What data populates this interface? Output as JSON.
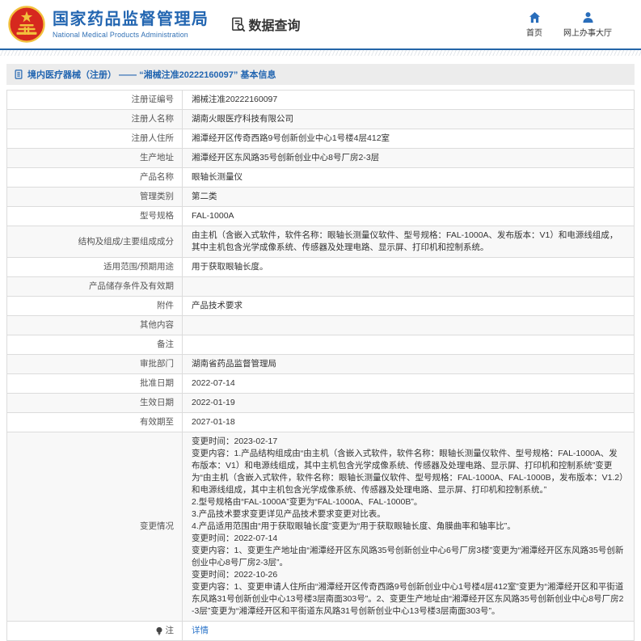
{
  "header": {
    "title": "国家药品监督管理局",
    "subtitle": "National Medical Products Administration",
    "section_label": "数据查询",
    "nav": [
      {
        "label": "首页",
        "icon": "home-icon"
      },
      {
        "label": "网上办事大厅",
        "icon": "user-icon"
      }
    ]
  },
  "breadcrumb": {
    "label": "境内医疗器械（注册） —— “湘械注准20222160097” 基本信息"
  },
  "colors": {
    "brand_blue": "#2366b1",
    "link_blue": "#2b74c9",
    "emblem_red": "#d6281e",
    "emblem_gold": "#f2c13d",
    "row_alt_bg": "#f8f8f8",
    "border_gray": "#dcdcdc"
  },
  "table": {
    "rows": [
      {
        "label": "注册证编号",
        "value": "湘械注准20222160097"
      },
      {
        "label": "注册人名称",
        "value": "湖南火眼医疗科技有限公司"
      },
      {
        "label": "注册人住所",
        "value": "湘潭经开区传奇西路9号创新创业中心1号楼4层412室"
      },
      {
        "label": "生产地址",
        "value": "湘潭经开区东风路35号创新创业中心8号厂房2-3层"
      },
      {
        "label": "产品名称",
        "value": "眼轴长测量仪"
      },
      {
        "label": "管理类别",
        "value": "第二类"
      },
      {
        "label": "型号规格",
        "value": "FAL-1000A"
      },
      {
        "label": "结构及组成/主要组成成分",
        "value": "由主机（含嵌入式软件，软件名称：眼轴长测量仪软件、型号规格：FAL-1000A、发布版本：V1）和电源线组成，其中主机包含光学成像系统、传感器及处理电路、显示屏、打印机和控制系统。"
      },
      {
        "label": "适用范围/预期用途",
        "value": "用于获取眼轴长度。"
      },
      {
        "label": "产品储存条件及有效期",
        "value": ""
      },
      {
        "label": "附件",
        "value": "产品技术要求"
      },
      {
        "label": "其他内容",
        "value": ""
      },
      {
        "label": "备注",
        "value": ""
      },
      {
        "label": "审批部门",
        "value": "湖南省药品监督管理局"
      },
      {
        "label": "批准日期",
        "value": "2022-07-14"
      },
      {
        "label": "生效日期",
        "value": "2022-01-19"
      },
      {
        "label": "有效期至",
        "value": "2027-01-18"
      },
      {
        "label": "变更情况",
        "value": "变更时间：2023-02-17\n变更内容：1.产品结构组成由“由主机（含嵌入式软件，软件名称：眼轴长测量仪软件、型号规格：FAL-1000A、发布版本：V1）和电源线组成，其中主机包含光学成像系统、传感器及处理电路、显示屏、打印机和控制系统”变更为“由主机（含嵌入式软件，软件名称：眼轴长测量仪软件、型号规格：FAL-1000A、FAL-1000B，发布版本：V1.2）和电源线组成，其中主机包含光学成像系统、传感器及处理电路、显示屏、打印机和控制系统。”\n2.型号规格由“FAL-1000A”变更为“FAL-1000A、FAL-1000B”。\n3.产品技术要求变更详见产品技术要求变更对比表。\n4.产品适用范围由“用于获取眼轴长度”变更为“用于获取眼轴长度、角膜曲率和轴率比”。\n变更时间：2022-07-14\n变更内容：1、变更生产地址由“湘潭经开区东风路35号创新创业中心6号厂房3楼”变更为“湘潭经开区东风路35号创新创业中心8号厂房2-3层”。\n变更时间：2022-10-26\n变更内容：1、变更申请人住所由“湘潭经开区传奇西路9号创新创业中心1号楼4层412室”变更为“湘潭经开区和平街道东风路31号创新创业中心13号楼3层南面303号”。2、变更生产地址由“湘潭经开区东风路35号创新创业中心8号厂房2-3层”变更为“湘潭经开区和平街道东风路31号创新创业中心13号楼3层南面303号”。"
      }
    ],
    "note_row": {
      "label": "注",
      "link_label": "详情"
    }
  }
}
